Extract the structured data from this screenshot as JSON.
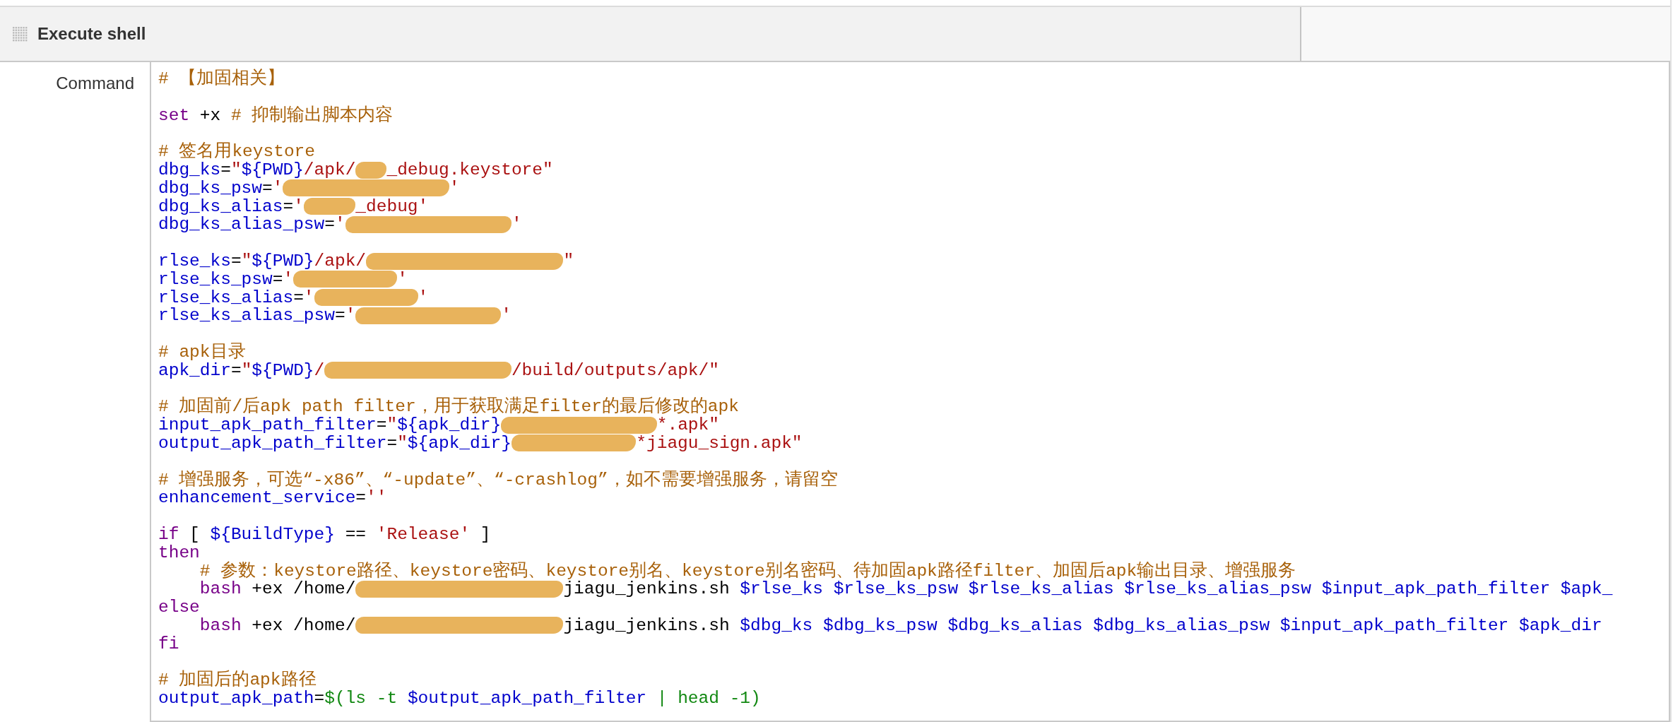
{
  "section": {
    "title": "Execute shell"
  },
  "command": {
    "label": "Command",
    "lines": [
      {
        "kind": "code",
        "segments": [
          {
            "kind": "comment",
            "text": "# 【加固相关】"
          }
        ]
      },
      {
        "kind": "blank"
      },
      {
        "kind": "code",
        "segments": [
          {
            "kind": "keyword",
            "text": "set"
          },
          {
            "kind": "plain",
            "text": " +x "
          },
          {
            "kind": "comment",
            "text": "# 抑制输出脚本内容"
          }
        ]
      },
      {
        "kind": "blank"
      },
      {
        "kind": "code",
        "segments": [
          {
            "kind": "comment",
            "text": "# 签名用keystore"
          }
        ]
      },
      {
        "kind": "code",
        "segments": [
          {
            "kind": "variable",
            "text": "dbg_ks"
          },
          {
            "kind": "plain",
            "text": "="
          },
          {
            "kind": "string",
            "text": "\""
          },
          {
            "kind": "variable",
            "text": "${PWD}"
          },
          {
            "kind": "string",
            "text": "/apk/"
          },
          {
            "kind": "redaction"
          },
          {
            "kind": "string",
            "text": "_debug.keystore\""
          }
        ]
      },
      {
        "kind": "code",
        "segments": [
          {
            "kind": "variable",
            "text": "dbg_ks_psw"
          },
          {
            "kind": "plain",
            "text": "="
          },
          {
            "kind": "string",
            "text": "'"
          },
          {
            "kind": "redaction"
          },
          {
            "kind": "string",
            "text": "'"
          }
        ]
      },
      {
        "kind": "code",
        "segments": [
          {
            "kind": "variable",
            "text": "dbg_ks_alias"
          },
          {
            "kind": "plain",
            "text": "="
          },
          {
            "kind": "string",
            "text": "'"
          },
          {
            "kind": "redaction"
          },
          {
            "kind": "string",
            "text": "_debug'"
          }
        ]
      },
      {
        "kind": "code",
        "segments": [
          {
            "kind": "variable",
            "text": "dbg_ks_alias_psw"
          },
          {
            "kind": "plain",
            "text": "="
          },
          {
            "kind": "string",
            "text": "'"
          },
          {
            "kind": "redaction"
          },
          {
            "kind": "string",
            "text": "'"
          }
        ]
      },
      {
        "kind": "blank"
      },
      {
        "kind": "code",
        "segments": [
          {
            "kind": "variable",
            "text": "rlse_ks"
          },
          {
            "kind": "plain",
            "text": "="
          },
          {
            "kind": "string",
            "text": "\""
          },
          {
            "kind": "variable",
            "text": "${PWD}"
          },
          {
            "kind": "string",
            "text": "/apk/"
          },
          {
            "kind": "redaction"
          },
          {
            "kind": "string",
            "text": "\""
          }
        ]
      },
      {
        "kind": "code",
        "segments": [
          {
            "kind": "variable",
            "text": "rlse_ks_psw"
          },
          {
            "kind": "plain",
            "text": "="
          },
          {
            "kind": "string",
            "text": "'"
          },
          {
            "kind": "redaction"
          },
          {
            "kind": "string",
            "text": "'"
          }
        ]
      },
      {
        "kind": "code",
        "segments": [
          {
            "kind": "variable",
            "text": "rlse_ks_alias"
          },
          {
            "kind": "plain",
            "text": "="
          },
          {
            "kind": "string",
            "text": "'"
          },
          {
            "kind": "redaction"
          },
          {
            "kind": "string",
            "text": "'"
          }
        ]
      },
      {
        "kind": "code",
        "segments": [
          {
            "kind": "variable",
            "text": "rlse_ks_alias_psw"
          },
          {
            "kind": "plain",
            "text": "="
          },
          {
            "kind": "string",
            "text": "'"
          },
          {
            "kind": "redaction"
          },
          {
            "kind": "string",
            "text": "'"
          }
        ]
      },
      {
        "kind": "blank"
      },
      {
        "kind": "code",
        "segments": [
          {
            "kind": "comment",
            "text": "# apk目录"
          }
        ]
      },
      {
        "kind": "code",
        "segments": [
          {
            "kind": "variable",
            "text": "apk_dir"
          },
          {
            "kind": "plain",
            "text": "="
          },
          {
            "kind": "string",
            "text": "\""
          },
          {
            "kind": "variable",
            "text": "${PWD}"
          },
          {
            "kind": "string",
            "text": "/"
          },
          {
            "kind": "redaction"
          },
          {
            "kind": "string",
            "text": "/build/outputs/apk/\""
          }
        ]
      },
      {
        "kind": "blank"
      },
      {
        "kind": "code",
        "segments": [
          {
            "kind": "comment",
            "text": "# 加固前/后apk path filter，用于获取满足filter的最后修改的apk"
          }
        ]
      },
      {
        "kind": "code",
        "segments": [
          {
            "kind": "variable",
            "text": "input_apk_path_filter"
          },
          {
            "kind": "plain",
            "text": "="
          },
          {
            "kind": "string",
            "text": "\""
          },
          {
            "kind": "variable",
            "text": "${apk_dir}"
          },
          {
            "kind": "redaction"
          },
          {
            "kind": "string",
            "text": "*.apk\""
          }
        ]
      },
      {
        "kind": "code",
        "segments": [
          {
            "kind": "variable",
            "text": "output_apk_path_filter"
          },
          {
            "kind": "plain",
            "text": "="
          },
          {
            "kind": "string",
            "text": "\""
          },
          {
            "kind": "variable",
            "text": "${apk_dir}"
          },
          {
            "kind": "redaction"
          },
          {
            "kind": "string",
            "text": "*jiagu_sign.apk\""
          }
        ]
      },
      {
        "kind": "blank"
      },
      {
        "kind": "code",
        "segments": [
          {
            "kind": "comment",
            "text": "# 增强服务，可选“-x86”、“-update”、“-crashlog”，如不需要增强服务，请留空"
          }
        ]
      },
      {
        "kind": "code",
        "segments": [
          {
            "kind": "variable",
            "text": "enhancement_service"
          },
          {
            "kind": "plain",
            "text": "="
          },
          {
            "kind": "string",
            "text": "''"
          }
        ]
      },
      {
        "kind": "blank"
      },
      {
        "kind": "code",
        "segments": [
          {
            "kind": "keyword",
            "text": "if"
          },
          {
            "kind": "plain",
            "text": " [ "
          },
          {
            "kind": "variable",
            "text": "${BuildType}"
          },
          {
            "kind": "plain",
            "text": " == "
          },
          {
            "kind": "string",
            "text": "'Release'"
          },
          {
            "kind": "plain",
            "text": " ]"
          }
        ]
      },
      {
        "kind": "code",
        "segments": [
          {
            "kind": "keyword",
            "text": "then"
          }
        ]
      },
      {
        "kind": "code",
        "indented": true,
        "segments": [
          {
            "kind": "comment",
            "text": "# 参数：keystore路径、keystore密码、keystore别名、keystore别名密码、待加固apk路径filter、加固后apk输出目录、增强服务"
          }
        ]
      },
      {
        "kind": "code",
        "indented": true,
        "segments": [
          {
            "kind": "keyword",
            "text": "bash"
          },
          {
            "kind": "plain",
            "text": " +ex /home/"
          },
          {
            "kind": "redaction"
          },
          {
            "kind": "plain",
            "text": "jiagu_jenkins.sh "
          },
          {
            "kind": "variable",
            "text": "$rlse_ks $rlse_ks_psw $rlse_ks_alias $rlse_ks_alias_psw $input_apk_path_filter $apk_"
          }
        ]
      },
      {
        "kind": "code",
        "segments": [
          {
            "kind": "keyword",
            "text": "else"
          }
        ]
      },
      {
        "kind": "code",
        "indented": true,
        "segments": [
          {
            "kind": "keyword",
            "text": "bash"
          },
          {
            "kind": "plain",
            "text": " +ex /home/"
          },
          {
            "kind": "redaction"
          },
          {
            "kind": "plain",
            "text": "jiagu_jenkins.sh "
          },
          {
            "kind": "variable",
            "text": "$dbg_ks $dbg_ks_psw $dbg_ks_alias $dbg_ks_alias_psw $input_apk_path_filter $apk_dir"
          }
        ]
      },
      {
        "kind": "code",
        "segments": [
          {
            "kind": "keyword",
            "text": "fi"
          }
        ]
      },
      {
        "kind": "blank"
      },
      {
        "kind": "code",
        "segments": [
          {
            "kind": "comment",
            "text": "# 加固后的apk路径"
          }
        ]
      },
      {
        "kind": "code",
        "segments": [
          {
            "kind": "variable",
            "text": "output_apk_path"
          },
          {
            "kind": "plain",
            "text": "="
          },
          {
            "kind": "builtin",
            "text": "$(ls -t "
          },
          {
            "kind": "variable",
            "text": "$output_apk_path_filter"
          },
          {
            "kind": "builtin",
            "text": " | head -1)"
          }
        ]
      }
    ]
  }
}
